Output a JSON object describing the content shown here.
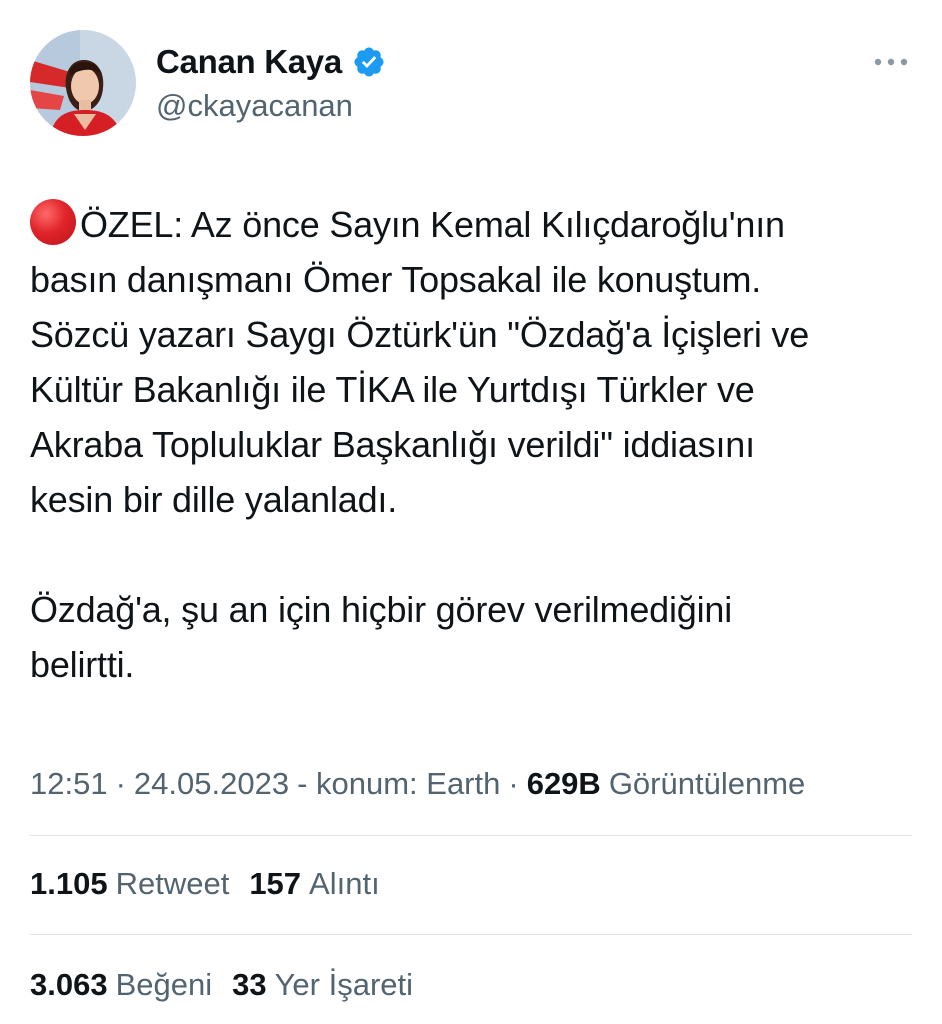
{
  "author": {
    "display_name": "Canan Kaya",
    "handle": "@ckayacanan",
    "verified": true
  },
  "tweet": {
    "paragraph_1": "ÖZEL: Az önce Sayın Kemal Kılıçdaroğlu'nın\nbasın danışmanı Ömer Topsakal ile konuştum.\nSözcü yazarı Saygı Öztürk'ün \"Özdağ'a İçişleri ve\nKültür Bakanlığı ile TİKA ile Yurtdışı Türkler ve\nAkraba Topluluklar Başkanlığı verildi\" iddiasını\nkesin bir dille yalanladı.",
    "paragraph_2": "Özdağ'a, şu an için hiçbir görev verilmediğini\nbelirtti.",
    "leading_emoji": "red-circle-icon"
  },
  "meta": {
    "time": "12:51",
    "separator": "·",
    "date": "24.05.2023",
    "location": "- konum: Earth",
    "views_count": "629B",
    "views_label": "Görüntülenme"
  },
  "stats_row_1": {
    "retweets_count": "1.105",
    "retweets_label": "Retweet",
    "quotes_count": "157",
    "quotes_label": "Alıntı"
  },
  "stats_row_2": {
    "likes_count": "3.063",
    "likes_label": "Beğeni",
    "bookmarks_count": "33",
    "bookmarks_label": "Yer İşareti"
  },
  "colors": {
    "text_primary": "#0f1419",
    "text_secondary": "#536471",
    "verified_blue": "#1d9bf0",
    "divider": "#dfe3e6"
  },
  "icons": [
    "avatar",
    "verified-badge-icon",
    "more-options-icon",
    "red-circle-icon"
  ]
}
